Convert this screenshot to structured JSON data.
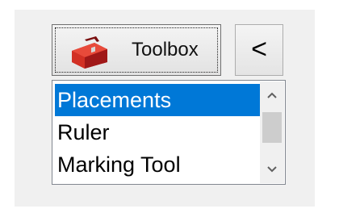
{
  "toolbox_button": {
    "label": "Toolbox",
    "icon": "red-toolbox-icon"
  },
  "collapse_button": {
    "label": "<"
  },
  "list": {
    "items": [
      {
        "label": "Placements",
        "selected": true
      },
      {
        "label": "Ruler",
        "selected": false
      },
      {
        "label": "Marking Tool",
        "selected": false
      }
    ],
    "selected_color": "#0078d7"
  },
  "scrollbar": {
    "up_icon": "chevron-up-icon",
    "down_icon": "chevron-down-icon"
  }
}
